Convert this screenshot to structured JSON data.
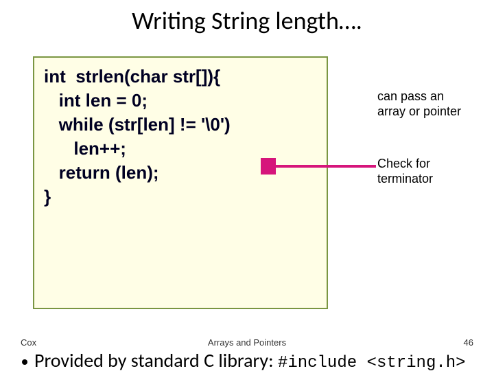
{
  "title": "Writing String length….",
  "code": {
    "l1": "int  strlen(char str[]){",
    "l2": "   int len = 0;",
    "l3": "",
    "l4": "   while (str[len] != '\\0')",
    "l5": "      len++;",
    "l6": "",
    "l7": "   return (len);",
    "l8": "}"
  },
  "annotations": [
    {
      "line1": "can pass an",
      "line2": "array or pointer"
    },
    {
      "line1": "Check for",
      "line2": "terminator"
    }
  ],
  "footer": {
    "left": "Cox",
    "center": "Arrays and Pointers",
    "right": "46"
  },
  "bullet": {
    "text": "Provided by standard C library:",
    "code": "#include <string.h>"
  }
}
